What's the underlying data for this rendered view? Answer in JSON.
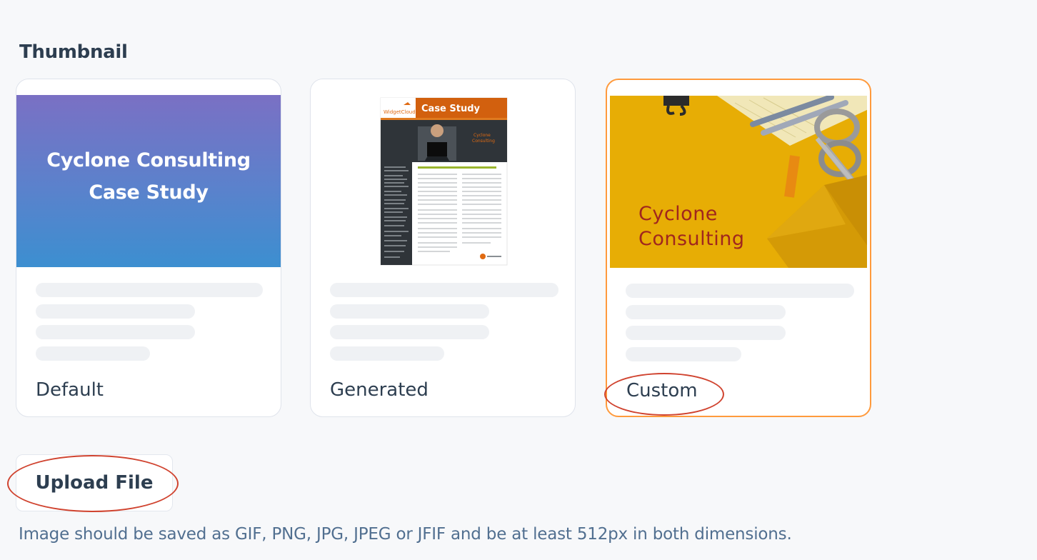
{
  "section": {
    "title": "Thumbnail"
  },
  "cards": [
    {
      "label": "Default",
      "thumb_text_1": "Cyclone Consulting",
      "thumb_text_2": "Case Study"
    },
    {
      "label": "Generated",
      "doc_header": "Case Study",
      "doc_brand": "WidgetCloud",
      "doc_subtitle_1": "Cyclone",
      "doc_subtitle_2": "Consulting"
    },
    {
      "label": "Custom",
      "thumb_text_1": "Cyclone",
      "thumb_text_2": "Consulting",
      "selected": true
    }
  ],
  "upload": {
    "label": "Upload File"
  },
  "helper_text": "Image should be saved as GIF, PNG, JPG, JPEG or JFIF and be at least 512px in both dimensions.",
  "colors": {
    "selected_border": "#ff9a3c",
    "annotation": "#d0432f",
    "doc_orange": "#e06a12",
    "custom_bg": "#e7ad05"
  }
}
